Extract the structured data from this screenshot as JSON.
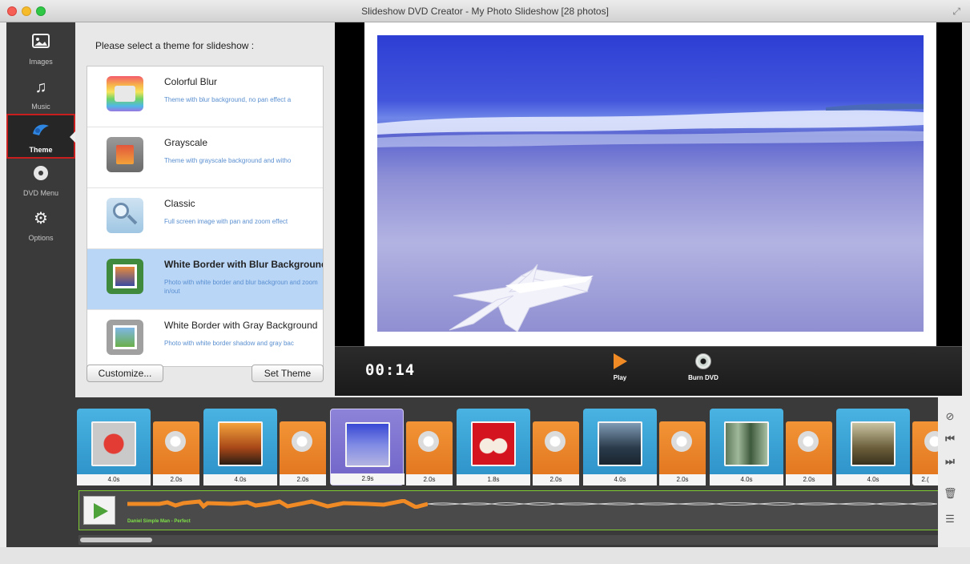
{
  "window": {
    "title": "Slideshow DVD Creator - My Photo Slideshow [28 photos]"
  },
  "sidebar": {
    "items": [
      {
        "label": "Images",
        "icon": "image-icon"
      },
      {
        "label": "Music",
        "icon": "music-note-icon"
      },
      {
        "label": "Theme",
        "icon": "theme-icon",
        "active": true
      },
      {
        "label": "DVD Menu",
        "icon": "dvd-icon"
      },
      {
        "label": "Options",
        "icon": "gear-icon"
      }
    ]
  },
  "theme_panel": {
    "title": "Please select a theme for slideshow :",
    "themes": [
      {
        "name": "Colorful Blur",
        "desc": "Theme with blur background, no pan effect a"
      },
      {
        "name": "Grayscale",
        "desc": "Theme with grayscale background and witho"
      },
      {
        "name": "Classic",
        "desc": "Full screen image with pan and zoom effect"
      },
      {
        "name": "White Border with Blur Background",
        "desc": "Photo with white border and blur backgroun and zoom in/out",
        "selected": true
      },
      {
        "name": "White Border with Gray Background",
        "desc": "Photo with white border shadow and gray bac"
      }
    ],
    "customize_label": "Customize...",
    "set_theme_label": "Set Theme"
  },
  "player": {
    "timecode": "00:14",
    "play_label": "Play",
    "burn_label": "Burn DVD"
  },
  "timeline": {
    "slides": [
      {
        "duration": "4.0s"
      },
      {
        "duration": "4.0s"
      },
      {
        "duration": "2.9s",
        "selected": true
      },
      {
        "duration": "1.8s"
      },
      {
        "duration": "4.0s"
      },
      {
        "duration": "4.0s"
      },
      {
        "duration": "4.0s"
      }
    ],
    "transitions": [
      {
        "duration": "2.0s"
      },
      {
        "duration": "2.0s"
      },
      {
        "duration": "2.0s"
      },
      {
        "duration": "2.0s"
      },
      {
        "duration": "2.0s"
      },
      {
        "duration": "2.0s"
      },
      {
        "duration": "2.("
      }
    ],
    "audio_track": "Daniel Simple Man - Perfect",
    "audio_progress": 0.35
  },
  "colors": {
    "accent_play": "#f08a24",
    "selected_theme": "#b9d6f7",
    "slide_blue": "#3aa3d6",
    "slide_selected": "#7c71d0",
    "audio_border": "#7ecb33"
  }
}
